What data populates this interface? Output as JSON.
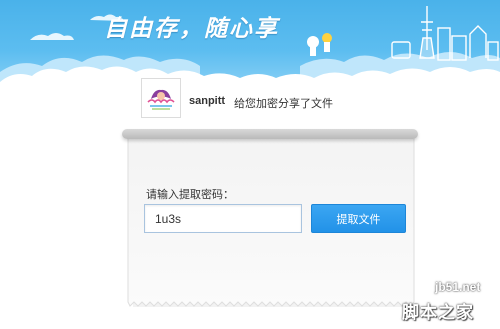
{
  "header": {
    "slogan": "自由存，随心享",
    "colors": {
      "sky": "#4ab2ea",
      "cloud": "#ffffff"
    }
  },
  "share": {
    "username": "sanpitt",
    "message": "给您加密分享了文件",
    "avatar_icon": "user-avatar-icon"
  },
  "form": {
    "label": "请输入提取密码：",
    "password_value": "1u3s",
    "submit_label": "提取文件",
    "accent": "#2292e8"
  },
  "watermark": {
    "url": "jb51.net",
    "site_name": "脚本之家"
  }
}
